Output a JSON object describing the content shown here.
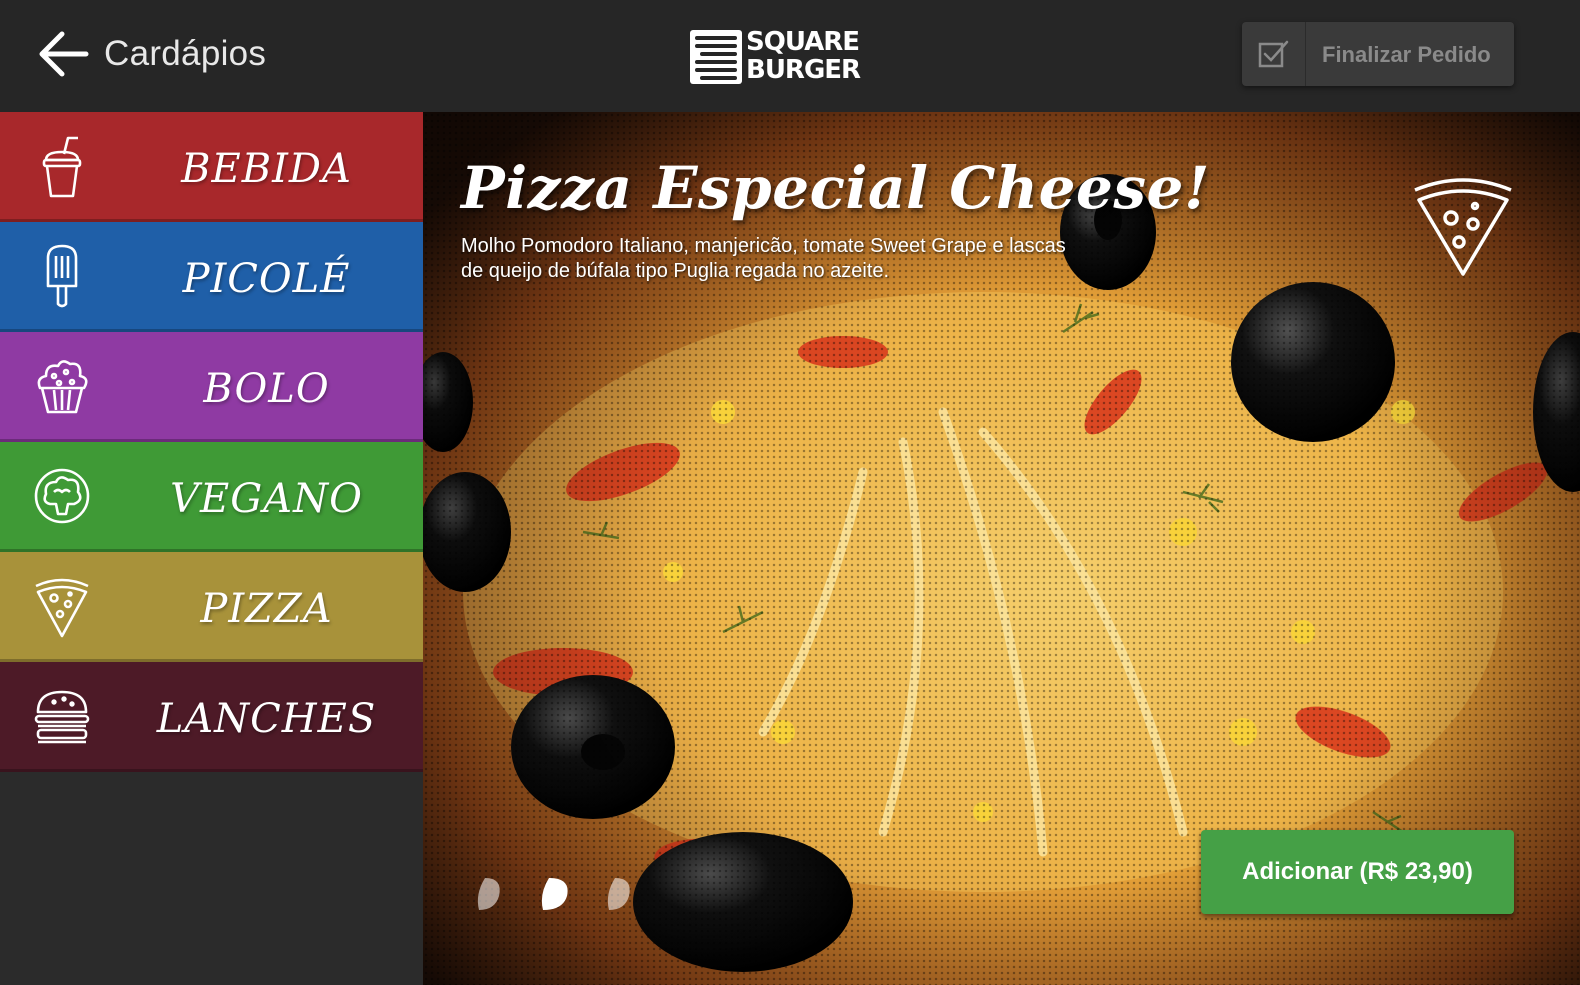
{
  "header": {
    "back_icon": "arrow-left-icon",
    "title": "Cardápios",
    "logo": {
      "line1": "SQUARE",
      "line2": "BURGER"
    },
    "finalizar": {
      "icon": "checkbox-check-icon",
      "label": "Finalizar Pedido"
    }
  },
  "sidebar": {
    "items": [
      {
        "label": "BEBIDA",
        "icon": "drink-cup-icon",
        "color": "#a8282b"
      },
      {
        "label": "PICOLÉ",
        "icon": "popsicle-icon",
        "color": "#1f5fa8"
      },
      {
        "label": "BOLO",
        "icon": "cupcake-icon",
        "color": "#8f3aa3"
      },
      {
        "label": "VEGANO",
        "icon": "broccoli-icon",
        "color": "#3f9a36"
      },
      {
        "label": "PIZZA",
        "icon": "pizza-slice-icon",
        "color": "#a8923a"
      },
      {
        "label": "LANCHES",
        "icon": "burger-icon",
        "color": "#4d1a27"
      }
    ]
  },
  "product": {
    "title": "Pizza Especial Cheese!",
    "description": "Molho Pomodoro Italiano, manjericão, tomate Sweet Grape e lascas de queijo de búfala tipo Puglia regada no azeite.",
    "category_icon": "pizza-slice-icon",
    "add_button": "Adicionar (R$ 23,90)",
    "pager": {
      "count": 3,
      "active": 2
    }
  }
}
